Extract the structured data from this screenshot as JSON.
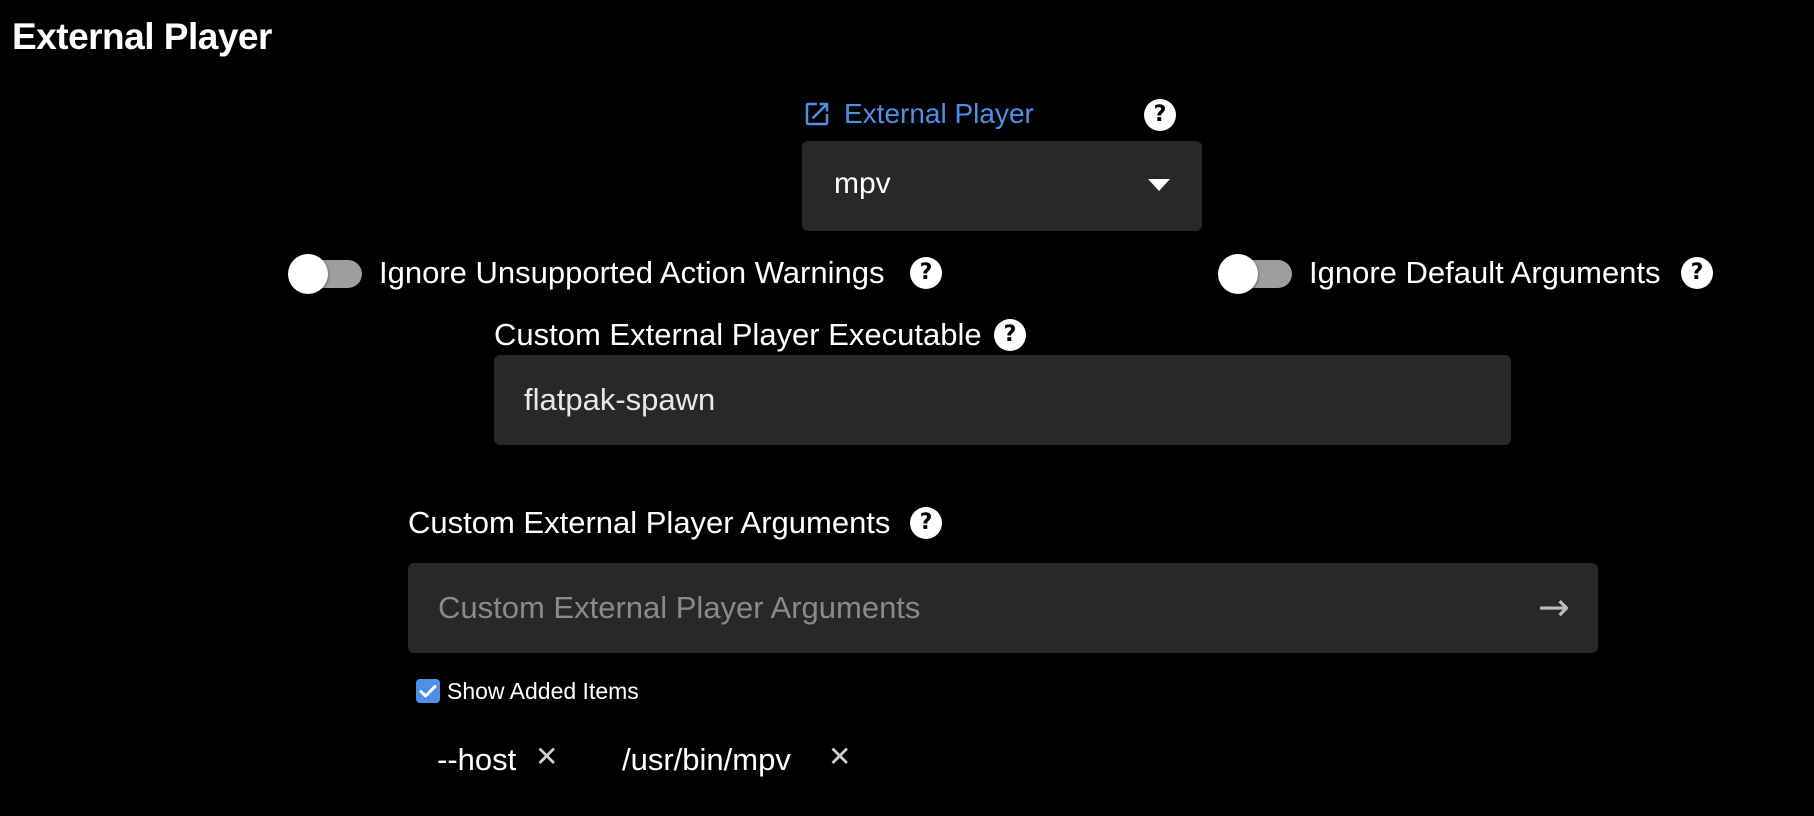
{
  "page": {
    "title": "External Player"
  },
  "external_player": {
    "label": "External Player",
    "selected": "mpv",
    "help": "?"
  },
  "toggles": [
    {
      "label": "Ignore Unsupported Action Warnings",
      "on": false,
      "help": "?"
    },
    {
      "label": "Ignore Default Arguments",
      "on": false,
      "help": "?"
    }
  ],
  "executable": {
    "label": "Custom External Player Executable",
    "value": "flatpak-spawn",
    "help": "?"
  },
  "arguments": {
    "label": "Custom External Player Arguments",
    "placeholder": "Custom External Player Arguments",
    "help": "?",
    "submit_icon": "arrow-right-icon",
    "show_added_label": "Show Added Items",
    "show_added_checked": true,
    "items": [
      "--host",
      "/usr/bin/mpv"
    ],
    "remove_glyph": "✕"
  },
  "colors": {
    "accent": "#4f8fe8",
    "background": "#000000",
    "field": "#282828"
  }
}
